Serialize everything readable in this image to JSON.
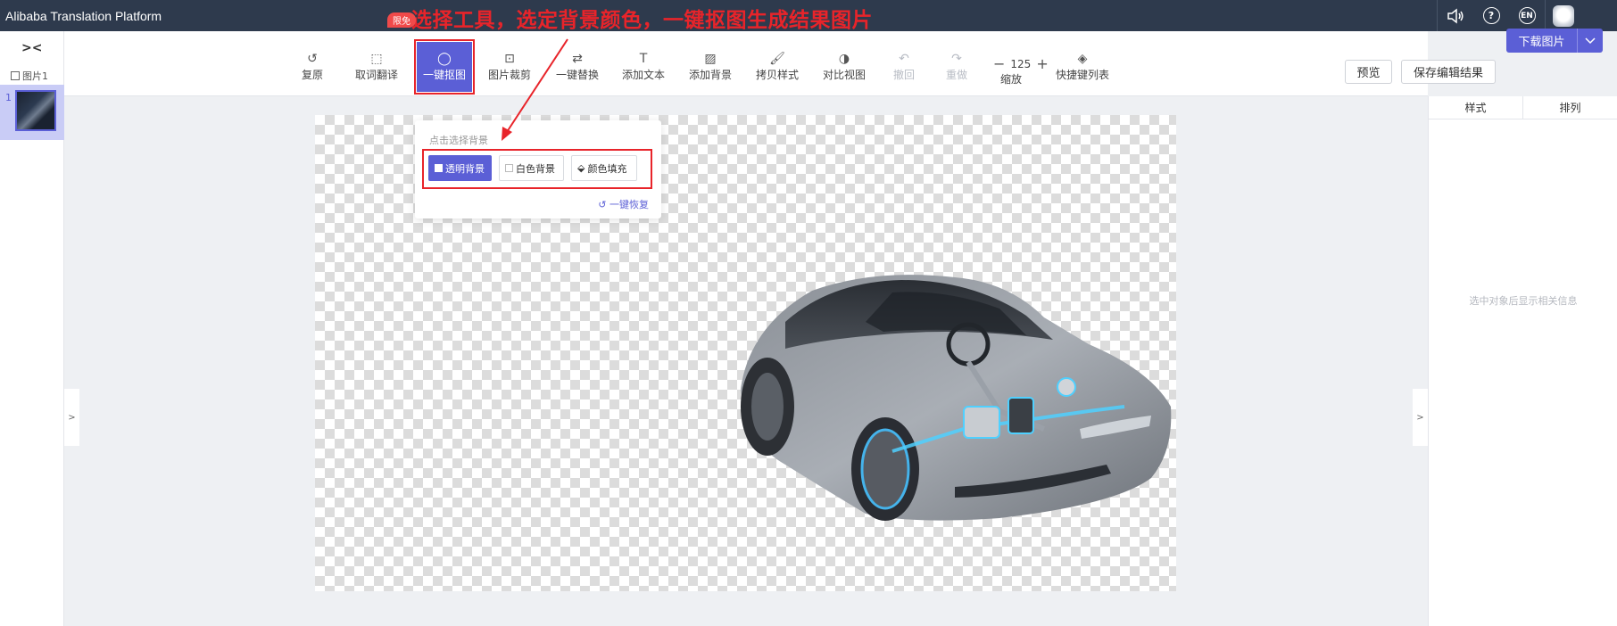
{
  "app": {
    "title": "Alibaba Translation Platform"
  },
  "annotation": {
    "text": "选择工具，选定背景颜色，一键抠图生成结果图片",
    "color": "#e8242a"
  },
  "topbar_icons": [
    {
      "name": "speaker-icon",
      "glyph": "🕪"
    },
    {
      "name": "help-icon",
      "glyph": "?"
    },
    {
      "name": "language-icon",
      "glyph": "EN"
    }
  ],
  "left_panel": {
    "collapse_glyph": ">‹",
    "pages_label": "图片1",
    "thumb_number": "1"
  },
  "toolbar": {
    "badge": "限免",
    "tools": [
      {
        "id": "restore",
        "label": "复原",
        "glyph": "↺",
        "state": "normal"
      },
      {
        "id": "select-translate",
        "label": "取词翻译",
        "glyph": "⬚",
        "state": "normal"
      },
      {
        "id": "cutout",
        "label": "一键抠图",
        "glyph": "◯",
        "state": "active"
      },
      {
        "id": "crop",
        "label": "图片裁剪",
        "glyph": "⊡",
        "state": "normal"
      },
      {
        "id": "replace",
        "label": "一键替换",
        "glyph": "⇄",
        "state": "normal"
      },
      {
        "id": "add-text",
        "label": "添加文本",
        "glyph": "T",
        "state": "normal"
      },
      {
        "id": "add-bg",
        "label": "添加背景",
        "glyph": "▨",
        "state": "normal"
      },
      {
        "id": "copy-style",
        "label": "拷贝样式",
        "glyph": "🖌",
        "state": "normal"
      },
      {
        "id": "compare",
        "label": "对比视图",
        "glyph": "◑",
        "state": "normal"
      },
      {
        "id": "undo",
        "label": "撤回",
        "glyph": "↶",
        "state": "disabled"
      },
      {
        "id": "redo",
        "label": "重做",
        "glyph": "↷",
        "state": "disabled"
      }
    ],
    "zoom": {
      "value": "125",
      "label": "缩放",
      "minus": "−",
      "plus": "+"
    },
    "shortcuts": {
      "label": "快捷键列表",
      "glyph": "◈"
    },
    "preview_label": "预览",
    "save_label": "保存编辑结果",
    "download_label": "下载图片",
    "download_arrow": "⌄"
  },
  "popover": {
    "title": "点击选择背景",
    "options": [
      {
        "label": "透明背景",
        "selected": true
      },
      {
        "label": "白色背景",
        "selected": false
      },
      {
        "label": "颜色填充",
        "selected": false
      }
    ],
    "restore_label": "一键恢复"
  },
  "right_panel": {
    "tabs": [
      "样式",
      "排列"
    ],
    "hint": "选中对象后显示相关信息"
  },
  "toggles": {
    "left": ">",
    "right": ">"
  },
  "colors": {
    "accent": "#5b5fd6",
    "topbar": "#2e3a4d",
    "highlight": "#e8242a"
  }
}
